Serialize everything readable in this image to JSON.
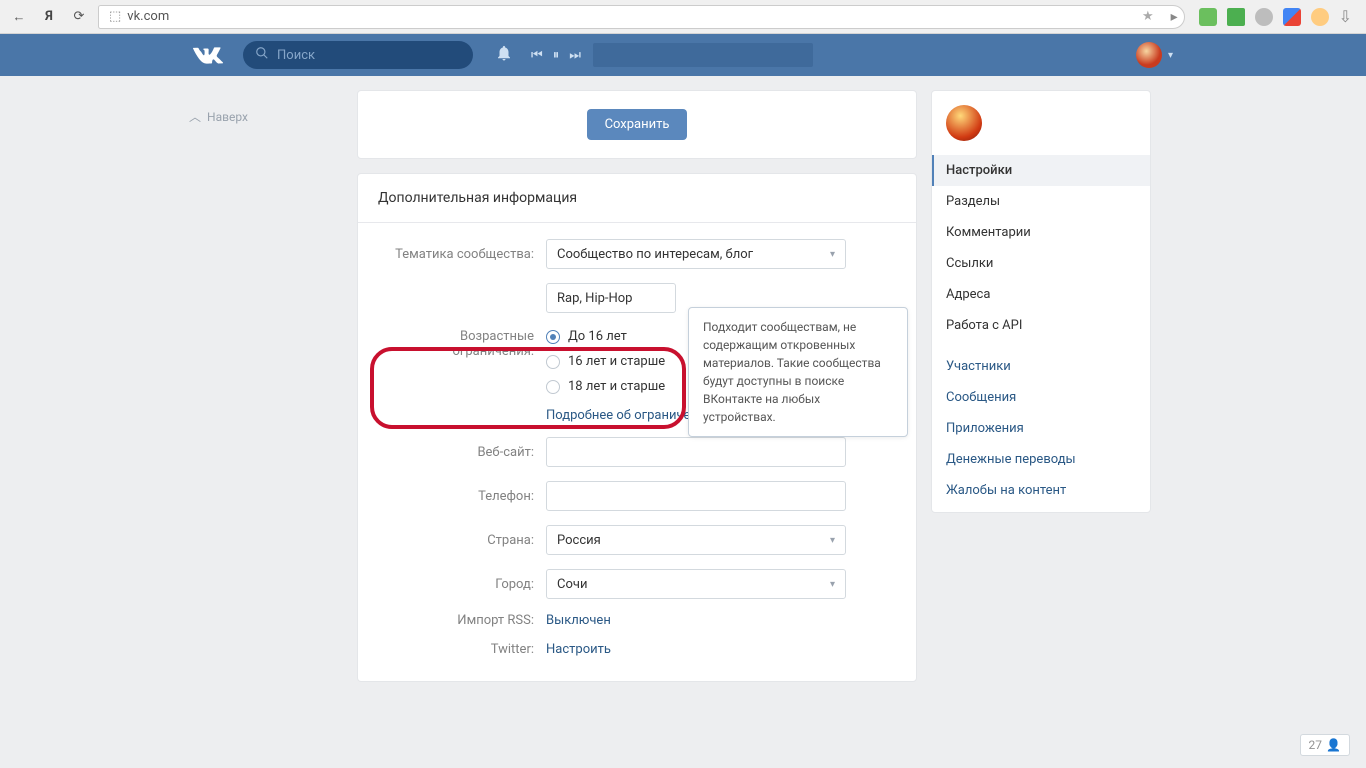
{
  "browser": {
    "address": "vk.com"
  },
  "top": {
    "search_placeholder": "Поиск"
  },
  "left": {
    "back_to_top": "Наверх"
  },
  "save_button": "Сохранить",
  "section_title": "Дополнительная информация",
  "labels": {
    "topic": "Тематика сообщества:",
    "age": "Возрастные ограничения:",
    "website": "Веб-сайт:",
    "phone": "Телефон:",
    "country": "Страна:",
    "city": "Город:",
    "rss": "Импорт RSS:",
    "twitter": "Twitter:"
  },
  "values": {
    "topic": "Сообщество по интересам, блог",
    "subtopic": "Rap, Hip-Hop",
    "country": "Россия",
    "city": "Сочи",
    "rss_link": "Выключен",
    "twitter_link": "Настроить"
  },
  "age_options": [
    "До 16 лет",
    "16 лет и старше",
    "18 лет и старше"
  ],
  "more_restrictions": "Подробнее об ограничениях",
  "tooltip": "Подходит сообществам, не содержащим откровенных материалов. Такие сообщества будут доступны в поиске ВКонтакте на любых устройствах.",
  "sidebar": {
    "settings_items": [
      "Настройки",
      "Разделы",
      "Комментарии",
      "Ссылки",
      "Адреса",
      "Работа с API"
    ],
    "link_items": [
      "Участники",
      "Сообщения",
      "Приложения",
      "Денежные переводы",
      "Жалобы на контент"
    ]
  },
  "corner_count": "27"
}
